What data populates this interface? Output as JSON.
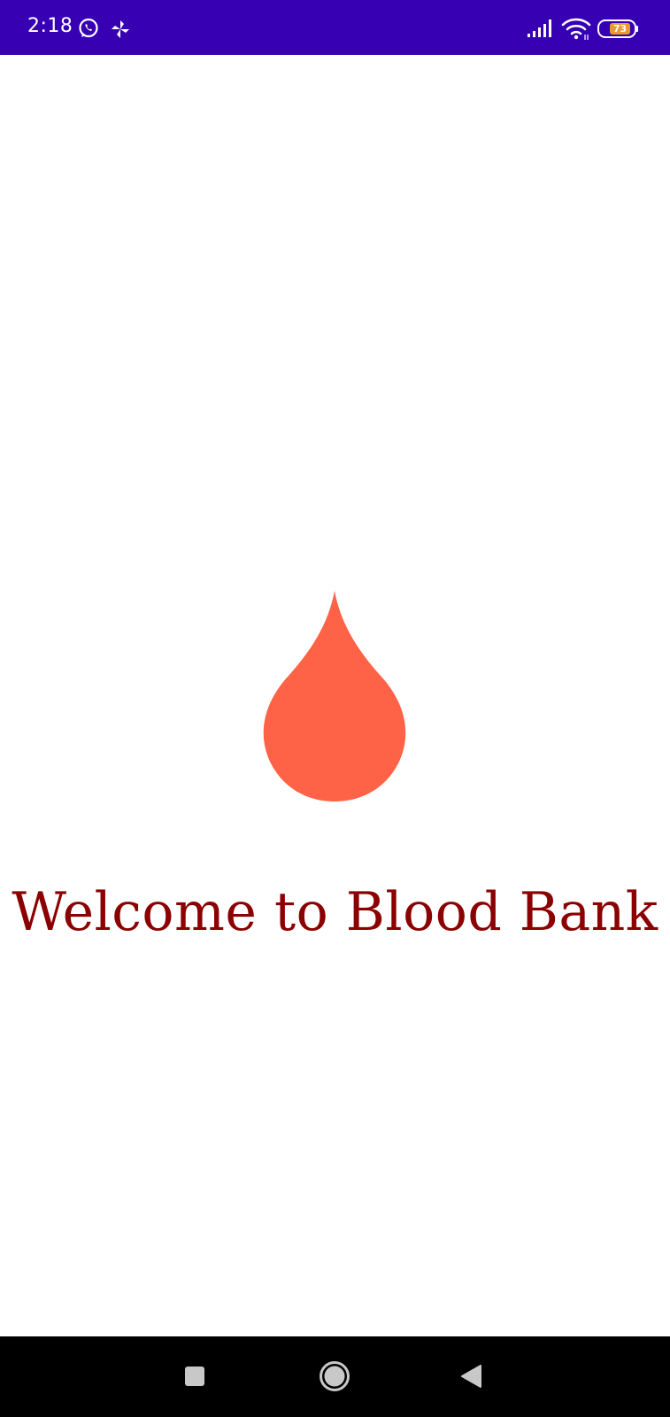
{
  "status_bar": {
    "time": "2:18",
    "battery_level": "73",
    "background_color": "#3700b3",
    "icons": [
      "whatsapp-icon",
      "pinwheel-icon",
      "signal-icon",
      "wifi-icon",
      "battery-icon"
    ]
  },
  "main": {
    "logo_icon": "blood-drop-icon",
    "logo_color": "#ff6347",
    "title": "Welcome to Blood Bank",
    "title_color": "#8b0000"
  },
  "nav_bar": {
    "icons": [
      "recents-icon",
      "home-icon",
      "back-icon"
    ]
  }
}
